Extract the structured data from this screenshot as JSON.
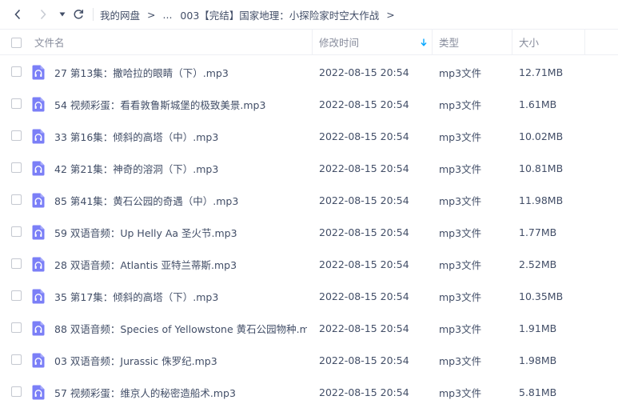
{
  "breadcrumb": {
    "items": [
      "我的网盘",
      "...",
      "003【完结】国家地理：小探险家时空大作战"
    ]
  },
  "columns": {
    "name": "文件名",
    "modified": "修改时间",
    "type": "类型",
    "size": "大小"
  },
  "colors": {
    "accent": "#7b7ff7",
    "sort_arrow": "#06a7ff",
    "text": "#424e67",
    "muted": "#878c9c"
  },
  "files": [
    {
      "name": "27 第13集：撒哈拉的眼睛（下）.mp3",
      "modified": "2022-08-15 20:54",
      "type": "mp3文件",
      "size": "12.71MB",
      "icon": "audio-file-icon"
    },
    {
      "name": "54 视频彩蛋：看看敦鲁斯城堡的极致美景.mp3",
      "modified": "2022-08-15 20:54",
      "type": "mp3文件",
      "size": "1.61MB",
      "icon": "audio-file-icon"
    },
    {
      "name": "33 第16集：倾斜的高塔（中）.mp3",
      "modified": "2022-08-15 20:54",
      "type": "mp3文件",
      "size": "10.02MB",
      "icon": "audio-file-icon"
    },
    {
      "name": "42 第21集：神奇的溶洞（下）.mp3",
      "modified": "2022-08-15 20:54",
      "type": "mp3文件",
      "size": "10.81MB",
      "icon": "audio-file-icon"
    },
    {
      "name": "85 第41集：黄石公园的奇遇（中）.mp3",
      "modified": "2022-08-15 20:54",
      "type": "mp3文件",
      "size": "11.98MB",
      "icon": "audio-file-icon"
    },
    {
      "name": "59 双语音频：Up Helly Aa 圣火节.mp3",
      "modified": "2022-08-15 20:54",
      "type": "mp3文件",
      "size": "1.77MB",
      "icon": "audio-file-icon"
    },
    {
      "name": "28 双语音频：Atlantis 亚特兰蒂斯.mp3",
      "modified": "2022-08-15 20:54",
      "type": "mp3文件",
      "size": "2.52MB",
      "icon": "audio-file-icon"
    },
    {
      "name": "35 第17集：倾斜的高塔（下）.mp3",
      "modified": "2022-08-15 20:54",
      "type": "mp3文件",
      "size": "10.35MB",
      "icon": "audio-file-icon"
    },
    {
      "name": "88 双语音频：Species of Yellowstone 黄石公园物种.m...",
      "modified": "2022-08-15 20:54",
      "type": "mp3文件",
      "size": "1.91MB",
      "icon": "audio-file-icon"
    },
    {
      "name": "03 双语音频：Jurassic 侏罗纪.mp3",
      "modified": "2022-08-15 20:54",
      "type": "mp3文件",
      "size": "1.98MB",
      "icon": "audio-file-icon"
    },
    {
      "name": "57 视频彩蛋：维京人的秘密造船术.mp3",
      "modified": "2022-08-15 20:54",
      "type": "mp3文件",
      "size": "5.81MB",
      "icon": "audio-file-icon"
    }
  ]
}
